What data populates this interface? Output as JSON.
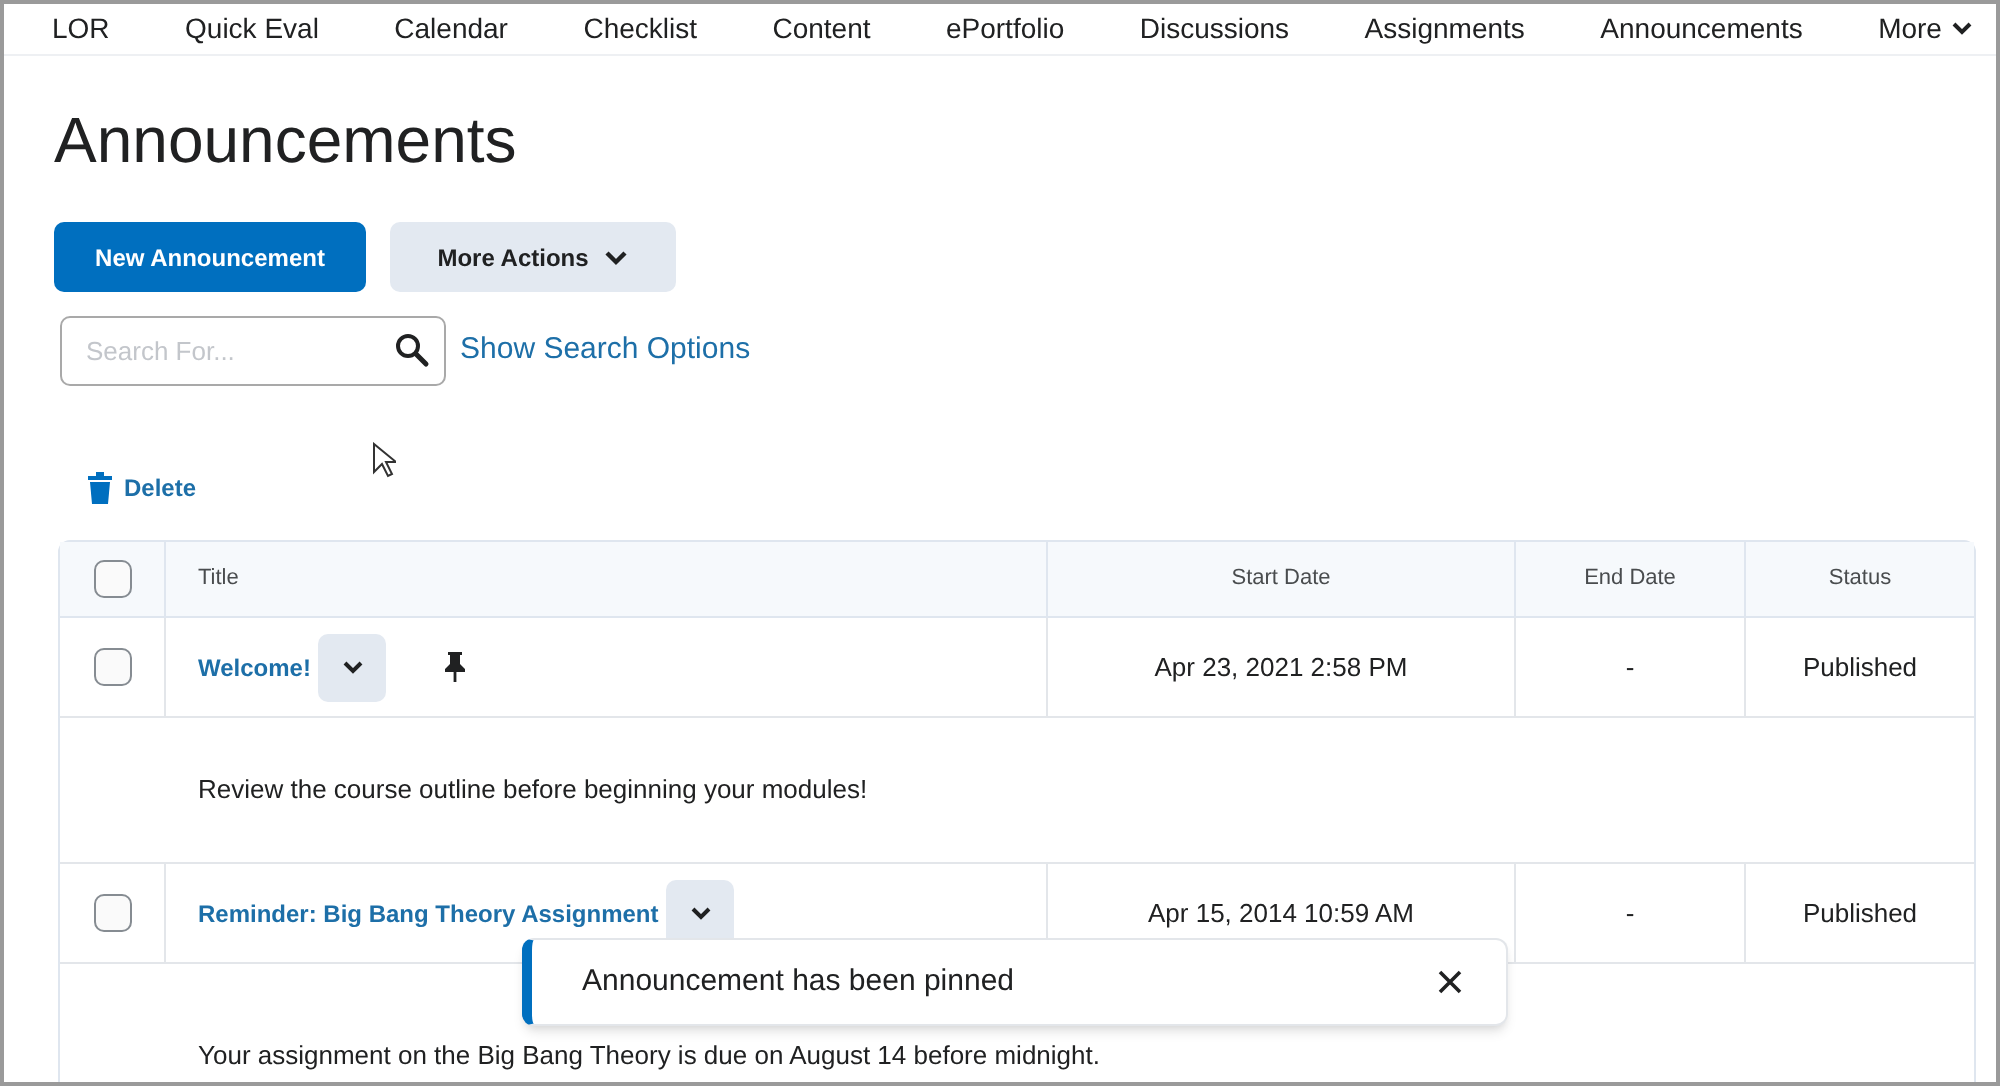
{
  "nav": {
    "items": [
      {
        "label": "LOR"
      },
      {
        "label": "Quick Eval"
      },
      {
        "label": "Calendar"
      },
      {
        "label": "Checklist"
      },
      {
        "label": "Content"
      },
      {
        "label": "ePortfolio"
      },
      {
        "label": "Discussions"
      },
      {
        "label": "Assignments"
      },
      {
        "label": "Announcements"
      }
    ],
    "more": "More"
  },
  "page_title": "Announcements",
  "actions": {
    "primary": "New Announcement",
    "secondary": "More Actions"
  },
  "search": {
    "placeholder": "Search For...",
    "options_link": "Show Search Options"
  },
  "delete": "Delete",
  "table": {
    "columns": [
      "Title",
      "Start Date",
      "End Date",
      "Status"
    ],
    "header_checked": false,
    "rows": [
      {
        "title": "Welcome!",
        "pinned": true,
        "start": "Apr 23, 2021 2:58 PM",
        "end": "-",
        "status": "Published",
        "checked": false,
        "body": "Review the course outline before beginning your modules!"
      },
      {
        "title": "Reminder: Big Bang Theory Assignment",
        "pinned": false,
        "start": "Apr 15, 2014 10:59 AM",
        "end": "-",
        "status": "Published",
        "checked": false,
        "body": "Your assignment on the Big Bang Theory is due on August 14 before midnight."
      }
    ]
  },
  "toast": {
    "message": "Announcement has been pinned"
  }
}
